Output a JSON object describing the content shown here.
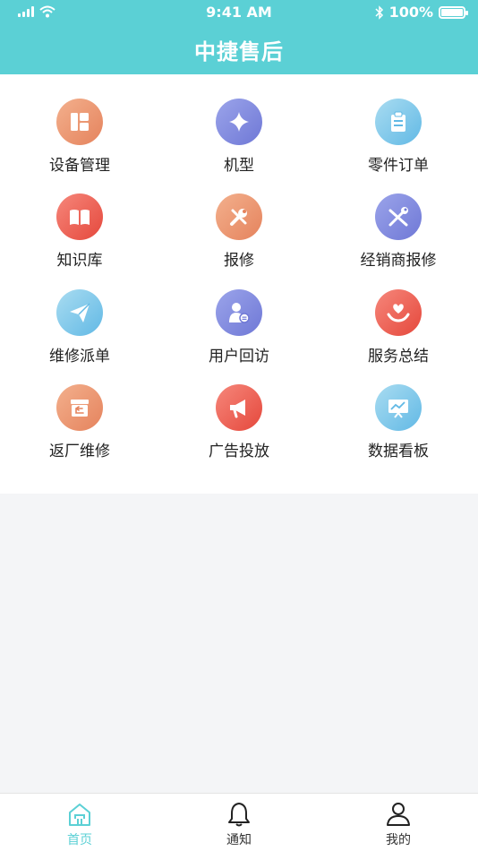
{
  "status_bar": {
    "time": "9:41 AM",
    "battery": "100%"
  },
  "header": {
    "title": "中捷售后"
  },
  "grid": [
    {
      "label": "设备管理",
      "icon": "layout-panel-icon",
      "color_a": "#f3b08d",
      "color_b": "#e5835d"
    },
    {
      "label": "机型",
      "icon": "sparkle-icon",
      "color_a": "#9ba4ea",
      "color_b": "#6f78d6"
    },
    {
      "label": "零件订单",
      "icon": "clipboard-icon",
      "color_a": "#a9dcf1",
      "color_b": "#62b9e5"
    },
    {
      "label": "知识库",
      "icon": "book-icon",
      "color_a": "#f6877b",
      "color_b": "#e5483c"
    },
    {
      "label": "报修",
      "icon": "wrench-screwdriver-icon",
      "color_a": "#f3b08d",
      "color_b": "#e5835d"
    },
    {
      "label": "经销商报修",
      "icon": "tools-icon",
      "color_a": "#9ba4ea",
      "color_b": "#6f78d6"
    },
    {
      "label": "维修派单",
      "icon": "paper-plane-icon",
      "color_a": "#a9dcf1",
      "color_b": "#62b9e5"
    },
    {
      "label": "用户回访",
      "icon": "user-chat-icon",
      "color_a": "#9ba4ea",
      "color_b": "#6f78d6"
    },
    {
      "label": "服务总结",
      "icon": "hand-heart-icon",
      "color_a": "#f6877b",
      "color_b": "#e5483c"
    },
    {
      "label": "返厂维修",
      "icon": "return-box-icon",
      "color_a": "#f3b08d",
      "color_b": "#e5835d"
    },
    {
      "label": "广告投放",
      "icon": "megaphone-icon",
      "color_a": "#f6877b",
      "color_b": "#e5483c"
    },
    {
      "label": "数据看板",
      "icon": "chart-board-icon",
      "color_a": "#a9dcf1",
      "color_b": "#62b9e5"
    }
  ],
  "tabs": [
    {
      "label": "首页",
      "icon": "home-icon",
      "active": true
    },
    {
      "label": "通知",
      "icon": "bell-icon",
      "active": false
    },
    {
      "label": "我的",
      "icon": "user-icon",
      "active": false
    }
  ],
  "colors": {
    "brand": "#5bd0d5",
    "background": "#f4f5f7"
  }
}
